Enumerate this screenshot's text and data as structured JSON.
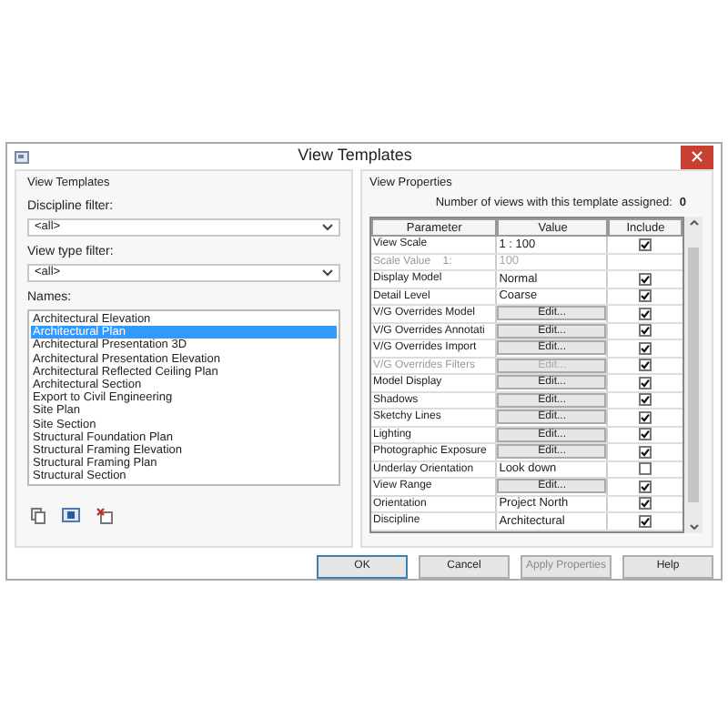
{
  "window": {
    "title": "View Templates"
  },
  "left_panel": {
    "title": "View Templates",
    "discipline_filter": {
      "label": "Discipline filter:",
      "value": "<all>"
    },
    "view_type_filter": {
      "label": "View type filter:",
      "value": "<all>"
    },
    "names_label": "Names:",
    "names": [
      {
        "label": "Architectural Elevation",
        "selected": false
      },
      {
        "label": "Architectural Plan",
        "selected": true
      },
      {
        "label": "Architectural Presentation 3D",
        "selected": false
      },
      {
        "label": "Architectural Presentation Elevation",
        "selected": false
      },
      {
        "label": "Architectural Reflected Ceiling Plan",
        "selected": false
      },
      {
        "label": "Architectural Section",
        "selected": false
      },
      {
        "label": "Export to Civil Engineering",
        "selected": false
      },
      {
        "label": "Site Plan",
        "selected": false
      },
      {
        "label": "Site Section",
        "selected": false
      },
      {
        "label": "Structural Foundation Plan",
        "selected": false
      },
      {
        "label": "Structural Framing Elevation",
        "selected": false
      },
      {
        "label": "Structural Framing Plan",
        "selected": false
      },
      {
        "label": "Structural Section",
        "selected": false
      }
    ]
  },
  "right_panel": {
    "title": "View Properties",
    "assigned_label": "Number of views with this template assigned:",
    "assigned_count": "0",
    "columns": [
      "Parameter",
      "Value",
      "Include"
    ],
    "rows": [
      {
        "parameter": "View Scale",
        "kind": "text",
        "value": "1 : 100",
        "disabled": false,
        "include": true
      },
      {
        "parameter": "Scale Value    1:",
        "kind": "text",
        "value": "100",
        "disabled": true
      },
      {
        "parameter": "Display Model",
        "kind": "text",
        "value": "Normal",
        "disabled": false,
        "include": true
      },
      {
        "parameter": "Detail Level",
        "kind": "text",
        "value": "Coarse",
        "disabled": false,
        "include": true
      },
      {
        "parameter": "V/G Overrides Model",
        "kind": "button",
        "value": "Edit...",
        "disabled": false,
        "include": true
      },
      {
        "parameter": "V/G Overrides Annotati",
        "kind": "button",
        "value": "Edit...",
        "disabled": false,
        "include": true
      },
      {
        "parameter": "V/G Overrides Import",
        "kind": "button",
        "value": "Edit...",
        "disabled": false,
        "include": true
      },
      {
        "parameter": "V/G Overrides Filters",
        "kind": "button",
        "value": "Edit...",
        "disabled": true,
        "include": true
      },
      {
        "parameter": "Model Display",
        "kind": "button",
        "value": "Edit...",
        "disabled": false,
        "include": true
      },
      {
        "parameter": "Shadows",
        "kind": "button",
        "value": "Edit...",
        "disabled": false,
        "include": true
      },
      {
        "parameter": "Sketchy Lines",
        "kind": "button",
        "value": "Edit...",
        "disabled": false,
        "include": true
      },
      {
        "parameter": "Lighting",
        "kind": "button",
        "value": "Edit...",
        "disabled": false,
        "include": true
      },
      {
        "parameter": "Photographic Exposure",
        "kind": "button",
        "value": "Edit...",
        "disabled": false,
        "include": true
      },
      {
        "parameter": "Underlay Orientation",
        "kind": "text",
        "value": "Look down",
        "disabled": false,
        "include": false
      },
      {
        "parameter": "View Range",
        "kind": "button",
        "value": "Edit...",
        "disabled": false,
        "include": true
      },
      {
        "parameter": "Orientation",
        "kind": "text",
        "value": "Project North",
        "disabled": false,
        "include": true
      },
      {
        "parameter": "Discipline",
        "kind": "text",
        "value": "Architectural",
        "disabled": false,
        "include": true
      }
    ]
  },
  "buttons": [
    {
      "label": "OK",
      "disabled": false
    },
    {
      "label": "Cancel",
      "disabled": false
    },
    {
      "label": "Apply Properties",
      "disabled": true
    },
    {
      "label": "Help",
      "disabled": false
    }
  ]
}
